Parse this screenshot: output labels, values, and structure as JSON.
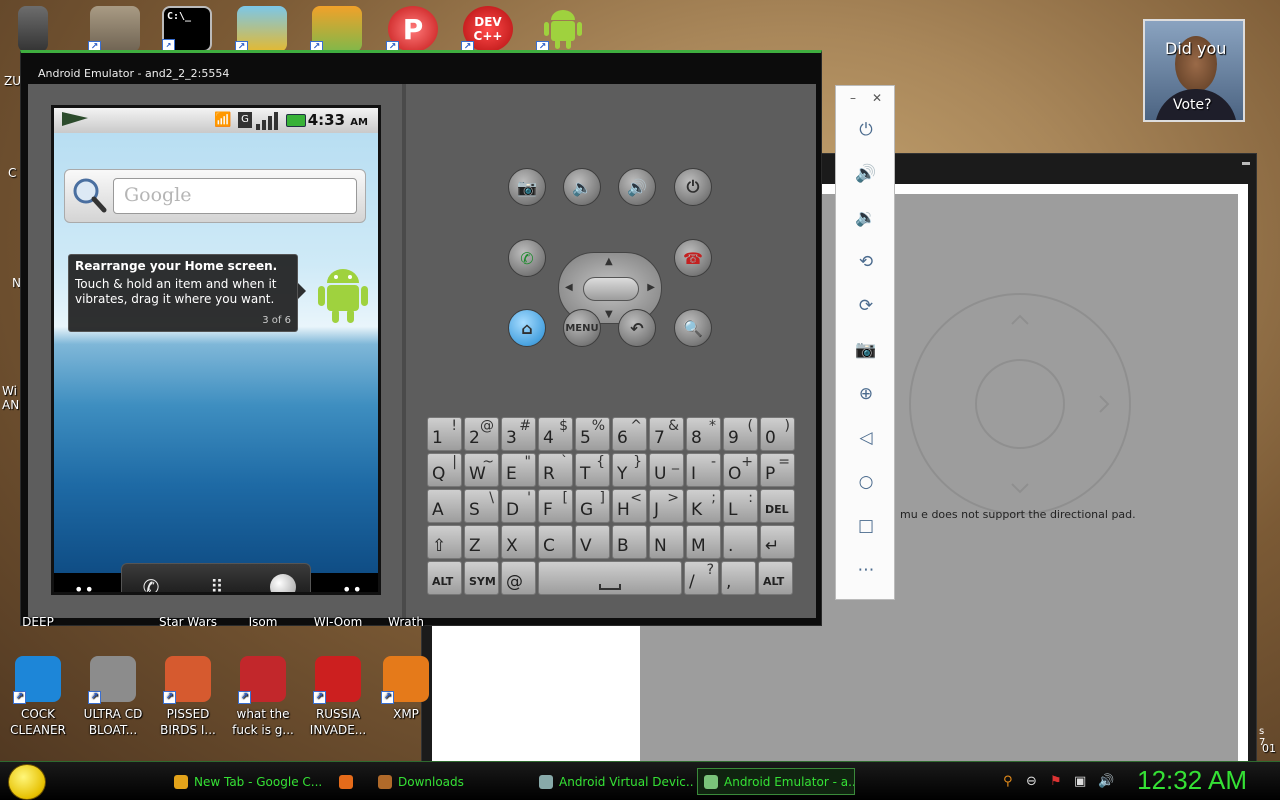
{
  "desktop": {
    "bottom_icons": [
      {
        "label": "COCK CLEANER",
        "color": "#1d86d8"
      },
      {
        "label": "ULTRA CD BLOAT...",
        "color": "#8c8c8c"
      },
      {
        "label": "PISSED BIRDS I...",
        "color": "#d65a2f"
      },
      {
        "label": "what the fuck is g...",
        "color": "#c2272b"
      },
      {
        "label": "RUSSIA INVADE...",
        "color": "#cc1f1f"
      },
      {
        "label": "XMP",
        "color": "#e57a1a"
      }
    ],
    "edge_labels": [
      "ZU",
      "C",
      "N",
      "Wi AN"
    ],
    "mid_labels": [
      "DEEP",
      "Star Wars",
      "Isom",
      "WI-Oom",
      "Wrath"
    ],
    "top_icons": [
      {
        "name": "cmd",
        "label": "C:\\_"
      },
      {
        "name": "photo",
        "label": ""
      },
      {
        "name": "pig",
        "label": ""
      },
      {
        "name": "pzip",
        "label": "P"
      },
      {
        "name": "devcpp",
        "label": "DEV C++"
      },
      {
        "name": "android",
        "label": ""
      }
    ]
  },
  "emulator": {
    "title": "Android Emulator - and2_2_2:5554",
    "phone": {
      "time": "4:33",
      "ampm": "AM",
      "search_placeholder": "Google",
      "tip_title": "Rearrange your Home screen.",
      "tip_text": "Touch & hold an item and when it vibrates, drag it where you want.",
      "tip_count": "3 of 6"
    },
    "controls": {
      "menu_label": "MENU"
    },
    "keyboard": {
      "row1": [
        {
          "m": "1",
          "s": "!"
        },
        {
          "m": "2",
          "s": "@"
        },
        {
          "m": "3",
          "s": "#"
        },
        {
          "m": "4",
          "s": "$"
        },
        {
          "m": "5",
          "s": "%"
        },
        {
          "m": "6",
          "s": "^"
        },
        {
          "m": "7",
          "s": "&"
        },
        {
          "m": "8",
          "s": "*"
        },
        {
          "m": "9",
          "s": "("
        },
        {
          "m": "0",
          "s": ")"
        }
      ],
      "row2": [
        {
          "m": "Q",
          "s": "|"
        },
        {
          "m": "W",
          "s": "~"
        },
        {
          "m": "E",
          "s": "\""
        },
        {
          "m": "R",
          "s": "`"
        },
        {
          "m": "T",
          "s": "{"
        },
        {
          "m": "Y",
          "s": "}"
        },
        {
          "m": "U",
          "s": "_"
        },
        {
          "m": "I",
          "s": "-"
        },
        {
          "m": "O",
          "s": "+"
        },
        {
          "m": "P",
          "s": "="
        }
      ],
      "row3": [
        {
          "m": "A",
          "s": ""
        },
        {
          "m": "S",
          "s": "\\"
        },
        {
          "m": "D",
          "s": "'"
        },
        {
          "m": "F",
          "s": "["
        },
        {
          "m": "G",
          "s": "]"
        },
        {
          "m": "H",
          "s": "<"
        },
        {
          "m": "J",
          "s": ">"
        },
        {
          "m": "K",
          "s": ";"
        },
        {
          "m": "L",
          "s": ":"
        },
        {
          "m": "DEL",
          "s": ""
        }
      ],
      "row4": [
        {
          "m": "⇧",
          "s": ""
        },
        {
          "m": "Z",
          "s": ""
        },
        {
          "m": "X",
          "s": ""
        },
        {
          "m": "C",
          "s": ""
        },
        {
          "m": "V",
          "s": ""
        },
        {
          "m": "B",
          "s": ""
        },
        {
          "m": "N",
          "s": ""
        },
        {
          "m": "M",
          "s": ""
        },
        {
          "m": ".",
          "s": ""
        },
        {
          "m": "↵",
          "s": ""
        }
      ],
      "row5_alt": "ALT",
      "row5_sym": "SYM",
      "row5_at": "@",
      "row5_slash": "/",
      "row5_q": "?",
      "row5_comma": ",",
      "row5_alt2": "ALT"
    }
  },
  "background_window": {
    "message": "mu            e does not support the directional pad.",
    "edge_text1": "s 7",
    "edge_text2": "01"
  },
  "badge": {
    "line1": "Did you",
    "line2": "Vote?"
  },
  "taskbar": {
    "tasks": [
      {
        "label": "New Tab - Google C...",
        "color": "#e3a31a"
      },
      {
        "label": "",
        "color": "#e56b1a"
      },
      {
        "label": "Downloads",
        "color": "#b06a2a"
      },
      {
        "label": "Android Virtual Devic...",
        "color": "#8aa"
      },
      {
        "label": "Android Emulator - a...",
        "color": "#7ac47a"
      }
    ],
    "clock": "12:32 AM"
  }
}
